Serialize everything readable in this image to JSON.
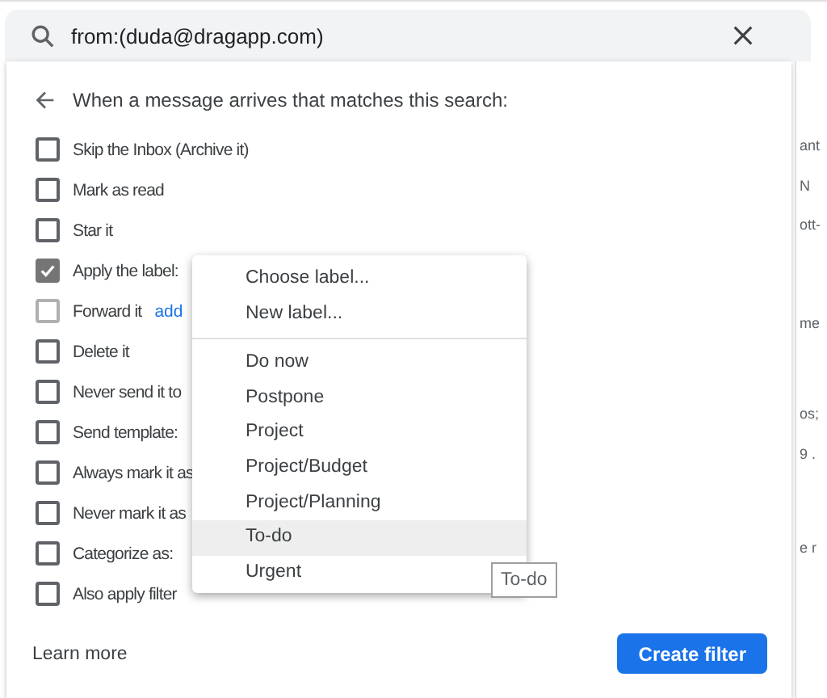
{
  "search": {
    "value": "from:(duda@dragapp.com)"
  },
  "filter_panel": {
    "heading": "When a message arrives that matches this search:",
    "options": [
      {
        "label": "Skip the Inbox (Archive it)",
        "checked": false,
        "disabled": false
      },
      {
        "label": "Mark as read",
        "checked": false,
        "disabled": false
      },
      {
        "label": "Star it",
        "checked": false,
        "disabled": false
      },
      {
        "label": "Apply the label:",
        "checked": true,
        "disabled": false
      },
      {
        "label": "Forward it",
        "checked": false,
        "disabled": true,
        "link": "add"
      },
      {
        "label": "Delete it",
        "checked": false,
        "disabled": false
      },
      {
        "label": "Never send it to",
        "checked": false,
        "disabled": false
      },
      {
        "label": "Send template:",
        "checked": false,
        "disabled": false
      },
      {
        "label": "Always mark it as",
        "checked": false,
        "disabled": false
      },
      {
        "label": "Never mark it as",
        "checked": false,
        "disabled": false
      },
      {
        "label": "Categorize as:",
        "checked": false,
        "disabled": false
      },
      {
        "label": "Also apply filter",
        "checked": false,
        "disabled": false
      }
    ],
    "learn_more": "Learn more",
    "create_button": "Create filter"
  },
  "label_menu": {
    "groups": [
      [
        {
          "label": "Choose label...",
          "selected": false
        },
        {
          "label": "New label...",
          "selected": false
        }
      ],
      [
        {
          "label": "Do now",
          "selected": false
        },
        {
          "label": "Postpone",
          "selected": false
        },
        {
          "label": "Project",
          "selected": false
        },
        {
          "label": "Project/Budget",
          "selected": false
        },
        {
          "label": "Project/Planning",
          "selected": false
        },
        {
          "label": "To-do",
          "selected": true
        },
        {
          "label": "Urgent",
          "selected": false
        }
      ]
    ]
  },
  "tooltip": "To-do",
  "background_list": [
    "ant",
    "N",
    "ott-",
    "me",
    "os;",
    "9 .",
    "e r"
  ]
}
